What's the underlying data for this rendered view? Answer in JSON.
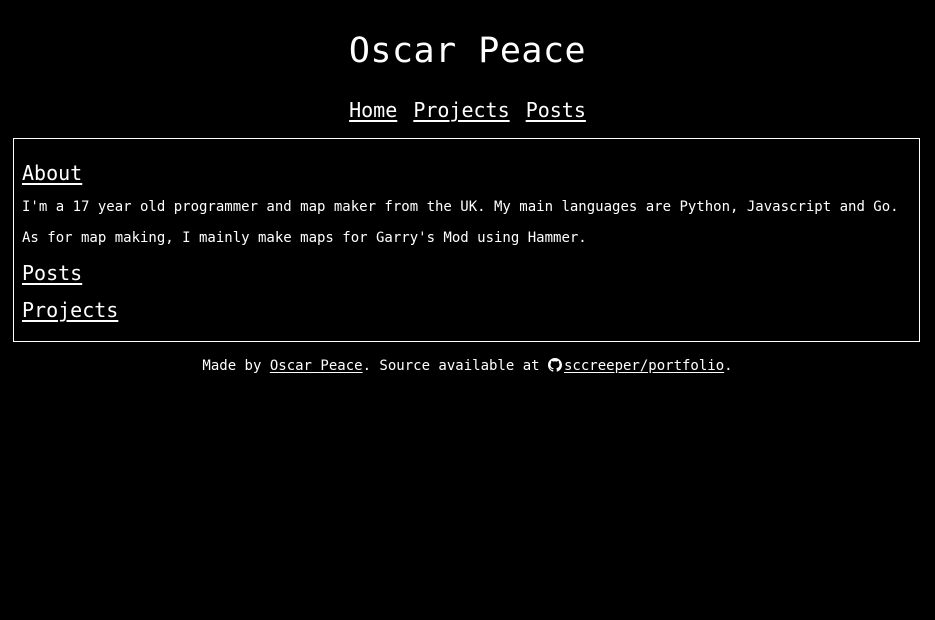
{
  "header": {
    "title": "Oscar Peace"
  },
  "nav": {
    "items": [
      {
        "label": "Home"
      },
      {
        "label": "Projects"
      },
      {
        "label": "Posts"
      }
    ]
  },
  "main": {
    "about_heading": "About",
    "about_paragraphs": [
      "I'm a 17 year old programmer and map maker from the UK. My main languages are Python, Javascript and Go.",
      "As for map making, I mainly make maps for Garry's Mod using Hammer."
    ],
    "posts_heading": "Posts",
    "projects_heading": "Projects"
  },
  "footer": {
    "prefix": "Made by ",
    "author_link": "Oscar Peace",
    "middle": ". Source available at ",
    "repo_link": "sccreeper/portfolio",
    "suffix": ".",
    "repo_icon": "github-icon"
  },
  "colors": {
    "background": "#000000",
    "text": "#ffffff",
    "border": "#ffffff"
  }
}
